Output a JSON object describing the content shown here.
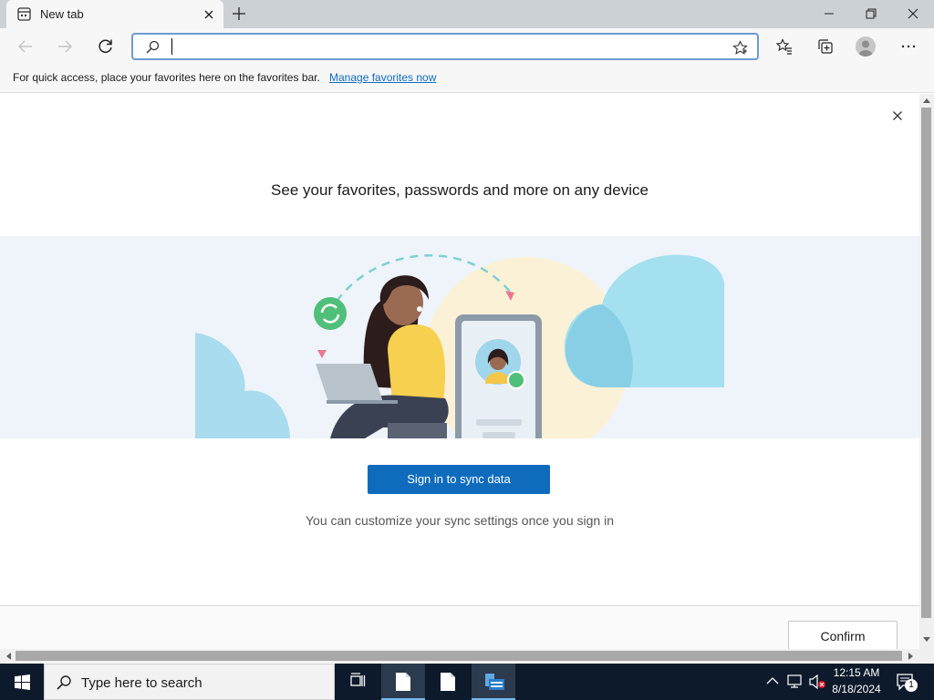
{
  "browser": {
    "tab_title": "New tab",
    "address_value": "",
    "address_placeholder": ""
  },
  "favorites_bar": {
    "text": "For quick access, place your favorites here on the favorites bar.",
    "link": "Manage favorites now"
  },
  "dialog": {
    "heading": "See your favorites, passwords and more on any device",
    "signin_button": "Sign in to sync data",
    "subtext": "You can customize your sync settings once you sign in",
    "confirm_button": "Confirm"
  },
  "taskbar": {
    "search_placeholder": "Type here to search",
    "time": "12:15 AM",
    "date": "8/18/2024",
    "notification_count": "1"
  },
  "colors": {
    "accent": "#0f6cbd",
    "taskbar_bg": "#0d1a2b",
    "hero_bg": "#eef4f9"
  },
  "icons": [
    "newtab-page-icon",
    "close-icon",
    "plus-icon",
    "minimize-icon",
    "restore-icon",
    "back-icon",
    "forward-icon",
    "refresh-icon",
    "search-icon",
    "star-icon",
    "favorites-icon",
    "collections-icon",
    "profile-icon",
    "more-icon",
    "windows-logo-icon",
    "task-view-icon",
    "file-icon",
    "app-icon",
    "chevron-up-icon",
    "network-icon",
    "volume-muted-icon",
    "notification-icon"
  ]
}
